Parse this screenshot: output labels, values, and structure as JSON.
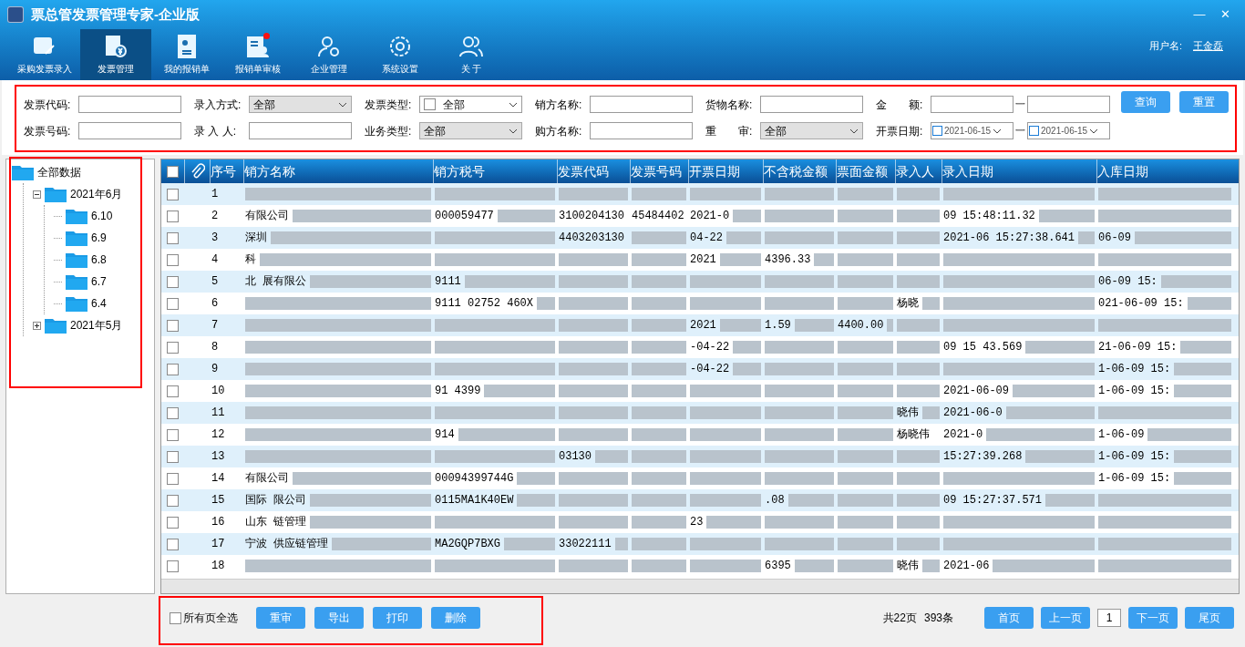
{
  "window": {
    "title": "票总管发票管理专家-企业版",
    "controls": [
      "—",
      "✕"
    ]
  },
  "toolbar": [
    {
      "label": "采购发票录入",
      "selected": false,
      "badge": false
    },
    {
      "label": "发票管理",
      "selected": true,
      "badge": false
    },
    {
      "label": "我的报销单",
      "selected": false,
      "badge": false
    },
    {
      "label": "报销单审核",
      "selected": false,
      "badge": true
    },
    {
      "label": "企业管理",
      "selected": false,
      "badge": false
    },
    {
      "label": "系统设置",
      "selected": false,
      "badge": false
    },
    {
      "label": "关 于",
      "selected": false,
      "badge": false
    }
  ],
  "user": {
    "label": "用户名:",
    "name": "王金磊"
  },
  "filters": {
    "row1": [
      {
        "kind": "text",
        "label": "发票代码:"
      },
      {
        "kind": "select",
        "label": "录入方式:",
        "value": "全部"
      },
      {
        "kind": "checkselect",
        "label": "发票类型:",
        "value": "全部",
        "checked": false
      },
      {
        "kind": "text",
        "label": "销方名称:"
      },
      {
        "kind": "text",
        "label": "货物名称:"
      },
      {
        "kind": "range",
        "label": "金　　额:",
        "sep": "一"
      }
    ],
    "row2": [
      {
        "kind": "text",
        "label": "发票号码:"
      },
      {
        "kind": "text",
        "label": "录 入 人:"
      },
      {
        "kind": "select",
        "label": "业务类型:",
        "value": "全部"
      },
      {
        "kind": "text",
        "label": "购方名称:"
      },
      {
        "kind": "select",
        "label": "重　　审:",
        "value": "全部"
      },
      {
        "kind": "daterange",
        "label": "开票日期:",
        "from": "2021-06-15",
        "to": "2021-06-15",
        "sep": "一"
      }
    ],
    "buttons": [
      "查询",
      "重置"
    ]
  },
  "tree": {
    "label": "全部数据",
    "children": [
      {
        "label": "2021年6月",
        "expanded": true,
        "children": [
          {
            "label": "6.10"
          },
          {
            "label": "6.9"
          },
          {
            "label": "6.8"
          },
          {
            "label": "6.7"
          },
          {
            "label": "6.4"
          }
        ]
      },
      {
        "label": "2021年5月",
        "expanded": false
      }
    ]
  },
  "table": {
    "all_checked": false,
    "columns": [
      "序号",
      "销方名称",
      "销方税号",
      "发票代码",
      "发票号码",
      "开票日期",
      "不含税金额",
      "票面金额",
      "录入人",
      "录入日期",
      "入库日期"
    ],
    "rows": [
      {
        "checked": false,
        "cells": [
          {
            "text": "1",
            "blurred": false
          },
          {
            "blurred": true
          },
          {
            "blurred": true
          },
          {
            "blurred": true
          },
          {
            "blurred": true
          },
          {
            "blurred": true
          },
          {
            "blurred": true
          },
          {
            "blurred": true
          },
          {
            "blurred": true
          },
          {
            "blurred": true
          },
          {
            "blurred": true
          }
        ]
      },
      {
        "checked": false,
        "cells": [
          {
            "text": "2",
            "blurred": false
          },
          {
            "text": "有限公司",
            "blurred": true
          },
          {
            "text": "000059477",
            "blurred": true
          },
          {
            "text": "3100204130",
            "blurred": false
          },
          {
            "text": "45484402",
            "blurred": false
          },
          {
            "text": "2021-0",
            "blurred": true
          },
          {
            "blurred": true
          },
          {
            "blurred": true
          },
          {
            "blurred": true
          },
          {
            "text": "09 15:48:11.32",
            "blurred": true
          },
          {
            "blurred": true
          }
        ]
      },
      {
        "checked": false,
        "cells": [
          {
            "text": "3",
            "blurred": false
          },
          {
            "text": "深圳",
            "blurred": true
          },
          {
            "blurred": true
          },
          {
            "text": "4403203130",
            "blurred": false
          },
          {
            "blurred": true
          },
          {
            "text": "04-22",
            "blurred": true
          },
          {
            "blurred": true
          },
          {
            "blurred": true
          },
          {
            "blurred": true
          },
          {
            "text": "2021-06 15:27:38.641",
            "blurred": true
          },
          {
            "text": "06-09",
            "blurred": true
          }
        ]
      },
      {
        "checked": false,
        "cells": [
          {
            "text": "4",
            "blurred": false
          },
          {
            "text": "科",
            "blurred": true
          },
          {
            "blurred": true
          },
          {
            "blurred": true
          },
          {
            "blurred": true
          },
          {
            "text": "2021",
            "blurred": true
          },
          {
            "text": "4396.33",
            "blurred": true
          },
          {
            "blurred": true
          },
          {
            "blurred": true
          },
          {
            "blurred": true
          },
          {
            "blurred": true
          }
        ]
      },
      {
        "checked": false,
        "cells": [
          {
            "text": "5",
            "blurred": false
          },
          {
            "text": "北 展有限公",
            "blurred": true
          },
          {
            "text": "9111",
            "blurred": true
          },
          {
            "blurred": true
          },
          {
            "blurred": true
          },
          {
            "blurred": true
          },
          {
            "blurred": true
          },
          {
            "blurred": true
          },
          {
            "blurred": true
          },
          {
            "blurred": true
          },
          {
            "text": "06-09 15:",
            "blurred": true
          }
        ]
      },
      {
        "checked": false,
        "cells": [
          {
            "text": "6",
            "blurred": false
          },
          {
            "blurred": true
          },
          {
            "text": "9111 02752 460X",
            "blurred": true
          },
          {
            "blurred": true
          },
          {
            "blurred": true
          },
          {
            "blurred": true
          },
          {
            "blurred": true
          },
          {
            "blurred": true
          },
          {
            "text": "杨晓",
            "blurred": true
          },
          {
            "blurred": true
          },
          {
            "text": "021-06-09 15:",
            "blurred": true
          }
        ]
      },
      {
        "checked": false,
        "cells": [
          {
            "text": "7",
            "blurred": false
          },
          {
            "blurred": true
          },
          {
            "blurred": true
          },
          {
            "blurred": true
          },
          {
            "blurred": true
          },
          {
            "text": "2021",
            "blurred": true
          },
          {
            "text": "1.59",
            "blurred": true
          },
          {
            "text": "4400.00",
            "blurred": true
          },
          {
            "blurred": true
          },
          {
            "blurred": true
          },
          {
            "blurred": true
          }
        ]
      },
      {
        "checked": false,
        "cells": [
          {
            "text": "8",
            "blurred": false
          },
          {
            "blurred": true
          },
          {
            "blurred": true
          },
          {
            "blurred": true
          },
          {
            "blurred": true
          },
          {
            "text": "-04-22",
            "blurred": true
          },
          {
            "blurred": true
          },
          {
            "blurred": true
          },
          {
            "blurred": true
          },
          {
            "text": "09 15 43.569",
            "blurred": true
          },
          {
            "text": "21-06-09 15:",
            "blurred": true
          }
        ]
      },
      {
        "checked": false,
        "cells": [
          {
            "text": "9",
            "blurred": false
          },
          {
            "blurred": true
          },
          {
            "blurred": true
          },
          {
            "blurred": true
          },
          {
            "blurred": true
          },
          {
            "text": "-04-22",
            "blurred": true
          },
          {
            "blurred": true
          },
          {
            "blurred": true
          },
          {
            "blurred": true
          },
          {
            "blurred": true
          },
          {
            "text": "1-06-09 15:",
            "blurred": true
          }
        ]
      },
      {
        "checked": false,
        "cells": [
          {
            "text": "10",
            "blurred": false
          },
          {
            "blurred": true
          },
          {
            "text": "91 4399",
            "blurred": true
          },
          {
            "blurred": true
          },
          {
            "blurred": true
          },
          {
            "blurred": true
          },
          {
            "blurred": true
          },
          {
            "blurred": true
          },
          {
            "blurred": true
          },
          {
            "text": "2021-06-09",
            "blurred": true
          },
          {
            "text": "1-06-09 15:",
            "blurred": true
          }
        ]
      },
      {
        "checked": false,
        "cells": [
          {
            "text": "11",
            "blurred": false
          },
          {
            "blurred": true
          },
          {
            "blurred": true
          },
          {
            "blurred": true
          },
          {
            "blurred": true
          },
          {
            "blurred": true
          },
          {
            "blurred": true
          },
          {
            "blurred": true
          },
          {
            "text": "晓伟",
            "blurred": true
          },
          {
            "text": "2021-06-0",
            "blurred": true
          },
          {
            "blurred": true
          }
        ]
      },
      {
        "checked": false,
        "cells": [
          {
            "text": "12",
            "blurred": false
          },
          {
            "blurred": true
          },
          {
            "text": "914",
            "blurred": true
          },
          {
            "blurred": true
          },
          {
            "blurred": true
          },
          {
            "blurred": true
          },
          {
            "blurred": true
          },
          {
            "blurred": true
          },
          {
            "text": "杨晓伟",
            "blurred": false
          },
          {
            "text": "2021-0",
            "blurred": true
          },
          {
            "text": "1-06-09",
            "blurred": true
          }
        ]
      },
      {
        "checked": false,
        "cells": [
          {
            "text": "13",
            "blurred": false
          },
          {
            "blurred": true
          },
          {
            "blurred": true
          },
          {
            "text": "03130",
            "blurred": true
          },
          {
            "blurred": true
          },
          {
            "blurred": true
          },
          {
            "blurred": true
          },
          {
            "blurred": true
          },
          {
            "blurred": true
          },
          {
            "text": "15:27:39.268",
            "blurred": true
          },
          {
            "text": "1-06-09 15:",
            "blurred": true
          }
        ]
      },
      {
        "checked": false,
        "cells": [
          {
            "text": "14",
            "blurred": false
          },
          {
            "text": "有限公司",
            "blurred": true
          },
          {
            "text": "00094399744G",
            "blurred": true
          },
          {
            "blurred": true
          },
          {
            "blurred": true
          },
          {
            "blurred": true
          },
          {
            "blurred": true
          },
          {
            "blurred": true
          },
          {
            "blurred": true
          },
          {
            "blurred": true
          },
          {
            "text": "1-06-09 15:",
            "blurred": true
          }
        ]
      },
      {
        "checked": false,
        "cells": [
          {
            "text": "15",
            "blurred": false
          },
          {
            "text": "国际 限公司",
            "blurred": true
          },
          {
            "text": "0115MA1K40EW",
            "blurred": true
          },
          {
            "blurred": true
          },
          {
            "blurred": true
          },
          {
            "blurred": true
          },
          {
            "text": ".08",
            "blurred": true
          },
          {
            "blurred": true
          },
          {
            "blurred": true
          },
          {
            "text": "09 15:27:37.571",
            "blurred": true
          },
          {
            "blurred": true
          }
        ]
      },
      {
        "checked": false,
        "cells": [
          {
            "text": "16",
            "blurred": false
          },
          {
            "text": "山东 链管理",
            "blurred": true
          },
          {
            "blurred": true
          },
          {
            "blurred": true
          },
          {
            "blurred": true
          },
          {
            "text": "23",
            "blurred": true
          },
          {
            "blurred": true
          },
          {
            "blurred": true
          },
          {
            "blurred": true
          },
          {
            "blurred": true
          },
          {
            "blurred": true
          }
        ]
      },
      {
        "checked": false,
        "cells": [
          {
            "text": "17",
            "blurred": false
          },
          {
            "text": "宁波 供应链管理",
            "blurred": true
          },
          {
            "text": "MA2GQP7BXG",
            "blurred": true
          },
          {
            "text": "33022111",
            "blurred": true
          },
          {
            "blurred": true
          },
          {
            "blurred": true
          },
          {
            "blurred": true
          },
          {
            "blurred": true
          },
          {
            "blurred": true
          },
          {
            "blurred": true
          },
          {
            "blurred": true
          }
        ]
      },
      {
        "checked": false,
        "cells": [
          {
            "text": "18",
            "blurred": false
          },
          {
            "blurred": true
          },
          {
            "blurred": true
          },
          {
            "blurred": true
          },
          {
            "blurred": true
          },
          {
            "blurred": true
          },
          {
            "text": "6395",
            "blurred": true
          },
          {
            "blurred": true
          },
          {
            "text": "晓伟",
            "blurred": true
          },
          {
            "text": "2021-06",
            "blurred": true
          },
          {
            "blurred": true
          }
        ]
      }
    ]
  },
  "footer": {
    "select_all": {
      "label": "所有页全选",
      "checked": false
    },
    "actions": [
      "重审",
      "导出",
      "打印",
      "删除"
    ],
    "summary": [
      "共22页",
      "393条"
    ],
    "pager": {
      "first": "首页",
      "prev": "上一页",
      "page": "1",
      "next": "下一页",
      "last": "尾页"
    }
  }
}
